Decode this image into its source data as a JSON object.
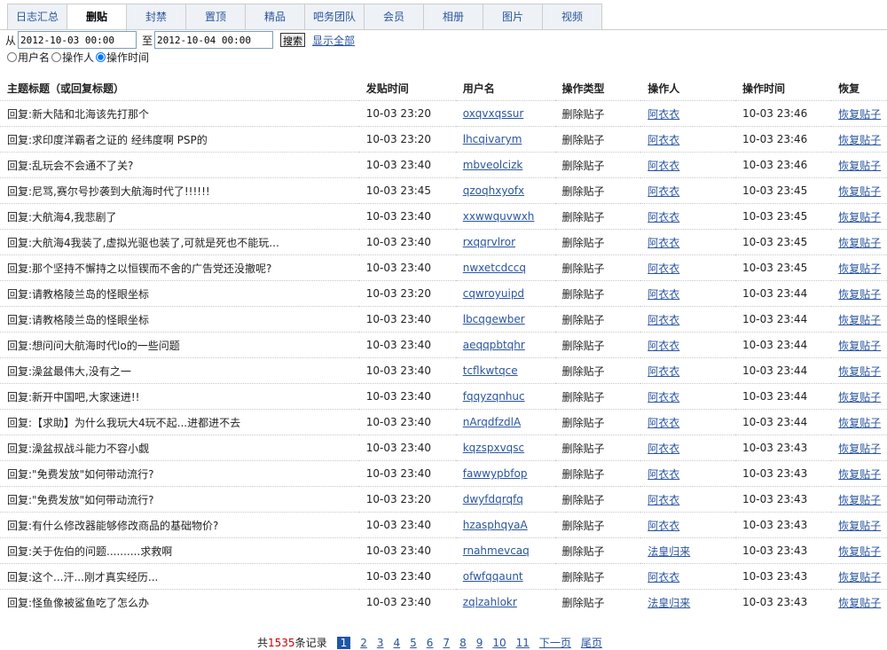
{
  "tabs": [
    "日志汇总",
    "删贴",
    "封禁",
    "置顶",
    "精品",
    "吧务团队",
    "会员",
    "相册",
    "图片",
    "视频"
  ],
  "active_tab": 1,
  "filter": {
    "from_label": "从",
    "from_value": "2012-10-03 00:00",
    "to_label": "至",
    "to_value": "2012-10-04 00:00",
    "search": "搜索",
    "show_all": "显示全部"
  },
  "radios": [
    "用户名",
    "操作人",
    "操作时间"
  ],
  "radio_selected": 2,
  "columns": [
    "主题标题（或回复标题）",
    "发贴时间",
    "用户名",
    "操作类型",
    "操作人",
    "操作时间",
    "恢复"
  ],
  "rows": [
    [
      "回复:新大陆和北海该先打那个",
      "10-03 23:20",
      "oxqvxqssur",
      "删除贴子",
      "阿衣衣",
      "10-03 23:46",
      "恢复贴子"
    ],
    [
      "回复:求印度洋霸者之证的 经纬度啊 PSP的",
      "10-03 23:20",
      "lhcqivarym",
      "删除贴子",
      "阿衣衣",
      "10-03 23:46",
      "恢复贴子"
    ],
    [
      "回复:乱玩会不会通不了关?",
      "10-03 23:40",
      "mbveolcizk",
      "删除贴子",
      "阿衣衣",
      "10-03 23:46",
      "恢复贴子"
    ],
    [
      "回复:尼骂,赛尔号抄袭到大航海时代了!!!!!!",
      "10-03 23:45",
      "qzoqhxyofx",
      "删除贴子",
      "阿衣衣",
      "10-03 23:45",
      "恢复贴子"
    ],
    [
      "回复:大航海4,我悲剧了",
      "10-03 23:40",
      "xxwwquvwxh",
      "删除贴子",
      "阿衣衣",
      "10-03 23:45",
      "恢复贴子"
    ],
    [
      "回复:大航海4我装了,虚拟光驱也装了,可就是死也不能玩...",
      "10-03 23:40",
      "rxqqrvlror",
      "删除贴子",
      "阿衣衣",
      "10-03 23:45",
      "恢复贴子"
    ],
    [
      "回复:那个坚持不懈持之以恒锲而不舍的广告党还没撤呢?",
      "10-03 23:40",
      "nwxetcdccq",
      "删除贴子",
      "阿衣衣",
      "10-03 23:45",
      "恢复贴子"
    ],
    [
      "回复:请教格陵兰岛的怪眼坐标",
      "10-03 23:20",
      "cqwroyuipd",
      "删除贴子",
      "阿衣衣",
      "10-03 23:44",
      "恢复贴子"
    ],
    [
      "回复:请教格陵兰岛的怪眼坐标",
      "10-03 23:40",
      "lbcqgewber",
      "删除贴子",
      "阿衣衣",
      "10-03 23:44",
      "恢复贴子"
    ],
    [
      "回复:想问问大航海时代lo的一些问题",
      "10-03 23:40",
      "aeqqpbtqhr",
      "删除贴子",
      "阿衣衣",
      "10-03 23:44",
      "恢复贴子"
    ],
    [
      "回复:澡盆最伟大,没有之一",
      "10-03 23:40",
      "tcflkwtqce",
      "删除贴子",
      "阿衣衣",
      "10-03 23:44",
      "恢复贴子"
    ],
    [
      "回复:新开中国吧,大家速进!!",
      "10-03 23:40",
      "fqqyzqnhuc",
      "删除贴子",
      "阿衣衣",
      "10-03 23:44",
      "恢复贴子"
    ],
    [
      "回复:【求助】为什么我玩大4玩不起...进都进不去",
      "10-03 23:40",
      "nArqdfzdlA",
      "删除贴子",
      "阿衣衣",
      "10-03 23:44",
      "恢复贴子"
    ],
    [
      "回复:澡盆叔战斗能力不容小觑",
      "10-03 23:40",
      "kqzspxvqsc",
      "删除贴子",
      "阿衣衣",
      "10-03 23:43",
      "恢复贴子"
    ],
    [
      "回复:\"免费发放\"如何带动流行?",
      "10-03 23:40",
      "fawwypbfop",
      "删除贴子",
      "阿衣衣",
      "10-03 23:43",
      "恢复贴子"
    ],
    [
      "回复:\"免费发放\"如何带动流行?",
      "10-03 23:20",
      "dwyfdqrqfq",
      "删除贴子",
      "阿衣衣",
      "10-03 23:43",
      "恢复贴子"
    ],
    [
      "回复:有什么修改器能够修改商品的基础物价?",
      "10-03 23:40",
      "hzasphqyaA",
      "删除贴子",
      "阿衣衣",
      "10-03 23:43",
      "恢复贴子"
    ],
    [
      "回复:关于佐伯的问题..........求救啊",
      "10-03 23:40",
      "rnahmevcaq",
      "删除贴子",
      "法皇归来",
      "10-03 23:43",
      "恢复贴子"
    ],
    [
      "回复:这个...汗...刚才真实经历...",
      "10-03 23:40",
      "ofwfqqaunt",
      "删除贴子",
      "阿衣衣",
      "10-03 23:43",
      "恢复贴子"
    ],
    [
      "回复:怪鱼像被鲨鱼吃了怎么办",
      "10-03 23:40",
      "zqlzahlokr",
      "删除贴子",
      "法皇归来",
      "10-03 23:43",
      "恢复贴子"
    ]
  ],
  "pager": {
    "prefix": "共",
    "total": "1535",
    "suffix": "条记录",
    "pages": [
      "1",
      "2",
      "3",
      "4",
      "5",
      "6",
      "7",
      "8",
      "9",
      "10",
      "11"
    ],
    "current": "1",
    "next": "下一页",
    "last": "尾页"
  }
}
